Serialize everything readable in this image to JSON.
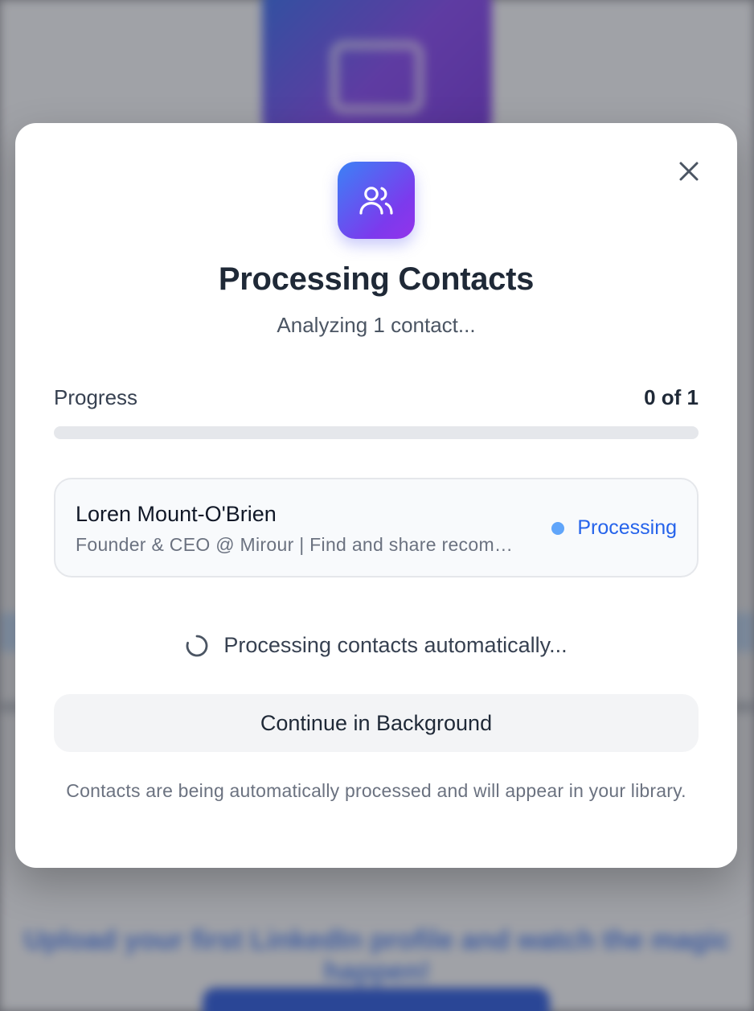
{
  "background": {
    "tagline": "Upload your first LinkedIn profile and watch the magic happen!",
    "hero_icon": "mail-icon"
  },
  "modal": {
    "header_icon": "users-icon",
    "title": "Processing Contacts",
    "subtitle": "Analyzing 1 contact...",
    "close_icon": "close-icon",
    "progress": {
      "label": "Progress",
      "count": "0 of 1",
      "completed": 0,
      "total": 1
    },
    "contacts": [
      {
        "name": "Loren Mount-O'Brien",
        "headline": "Founder & CEO @ Mirour | Find and share recommendations",
        "status": "Processing"
      }
    ],
    "auto_status": "Processing contacts automatically...",
    "continue_button": "Continue in Background",
    "footnote": "Contacts are being automatically processed and will appear in your library."
  },
  "colors": {
    "accent_blue": "#2563eb",
    "status_dot": "#60a5fa",
    "gradient_start": "#3b82f6",
    "gradient_end": "#9333ea"
  }
}
